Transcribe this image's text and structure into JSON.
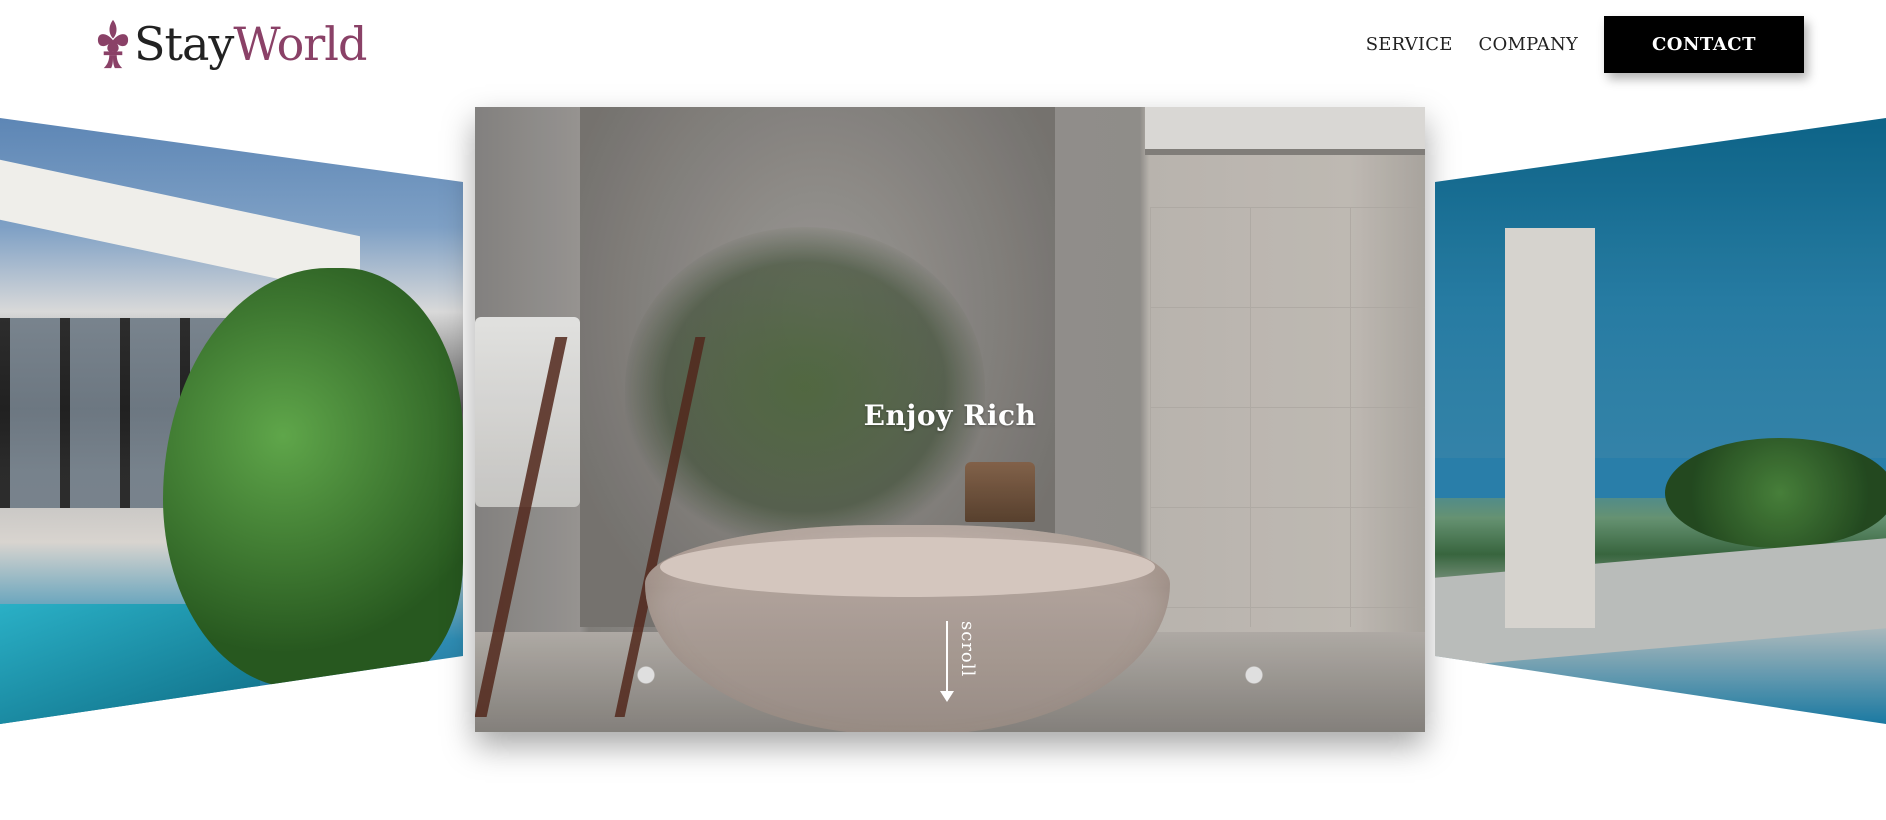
{
  "header": {
    "logo": {
      "text_a": "Stay",
      "text_b": "World",
      "icon": "fleur-de-lis-icon",
      "accent_color": "#8a4167"
    },
    "nav": {
      "items": [
        {
          "label": "SERVICE"
        },
        {
          "label": "COMPANY"
        }
      ],
      "contact_label": "CONTACT"
    }
  },
  "hero": {
    "title": "Enjoy Rich",
    "scroll_label": "scroll"
  },
  "slides": [
    {
      "name": "villa-pool-left",
      "active": false
    },
    {
      "name": "bathtub-center",
      "active": true
    },
    {
      "name": "seaside-infinity-pool-right",
      "active": false
    }
  ],
  "colors": {
    "background": "#ffffff",
    "button_bg": "#000000",
    "button_text": "#ffffff",
    "text_dark": "#222222"
  }
}
